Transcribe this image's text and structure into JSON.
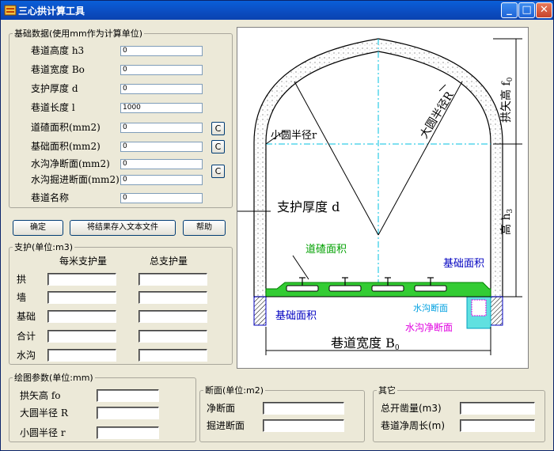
{
  "window": {
    "title": "三心拱计算工具",
    "buttons": {
      "minimize": "_",
      "maximize": "□",
      "close": "✕"
    }
  },
  "basic": {
    "legend": "基础数据(使用mm作为计算单位)",
    "fields": [
      {
        "label": "巷道高度 h3",
        "value": "0"
      },
      {
        "label": "巷道宽度 Bo",
        "value": "0"
      },
      {
        "label": "支护厚度 d",
        "value": "0"
      },
      {
        "label": "巷道长度 l",
        "value": "1000"
      },
      {
        "label": "道碴面积(mm2)",
        "value": "0"
      },
      {
        "label": "基础面积(mm2)",
        "value": "0"
      },
      {
        "label": "水沟净断面(mm2)",
        "value": "0"
      },
      {
        "label": "水沟掘进断面(mm2)",
        "value": "0"
      },
      {
        "label": "巷道名称",
        "value": "0"
      }
    ],
    "c_label": "C"
  },
  "actions": {
    "confirm": "确定",
    "save": "将结果存入文本文件",
    "help": "帮助"
  },
  "support": {
    "legend": "支护(单位:m3)",
    "col_per_meter": "每米支护量",
    "col_total": "总支护量",
    "rows": [
      "拱",
      "墙",
      "基础",
      "合计",
      "水沟"
    ]
  },
  "drawing": {
    "legend": "绘图参数(单位:mm)",
    "rows": [
      "拱矢高 fo",
      "大圆半径 R",
      "小圆半径 r"
    ]
  },
  "section": {
    "legend": "断面(单位:m2)",
    "rows": [
      "净断面",
      "掘进断面"
    ]
  },
  "other": {
    "legend": "其它",
    "rows": [
      "总开凿量(m3)",
      "巷道净周长(m)"
    ]
  },
  "diagram_labels": {
    "big_radius": "大圆半径R",
    "small_radius": "小圆半径r",
    "support_thickness": "支护厚度 d",
    "ballast_area": "道碴面积",
    "foundation_area_right": "基础面积",
    "foundation_area_left": "基础面积",
    "ditch_section": "水沟断面",
    "ditch_net_section": "水沟净断面",
    "width": "巷道宽度 B",
    "width_sub": "0",
    "arch_height": "拱矢高 f",
    "arch_height_sub": "0",
    "height": "高 h",
    "height_sub": "3"
  },
  "colors": {
    "green": "#33cc33",
    "cyan": "#00c0e0",
    "magenta": "#e000e0",
    "blue": "#0000c0"
  }
}
